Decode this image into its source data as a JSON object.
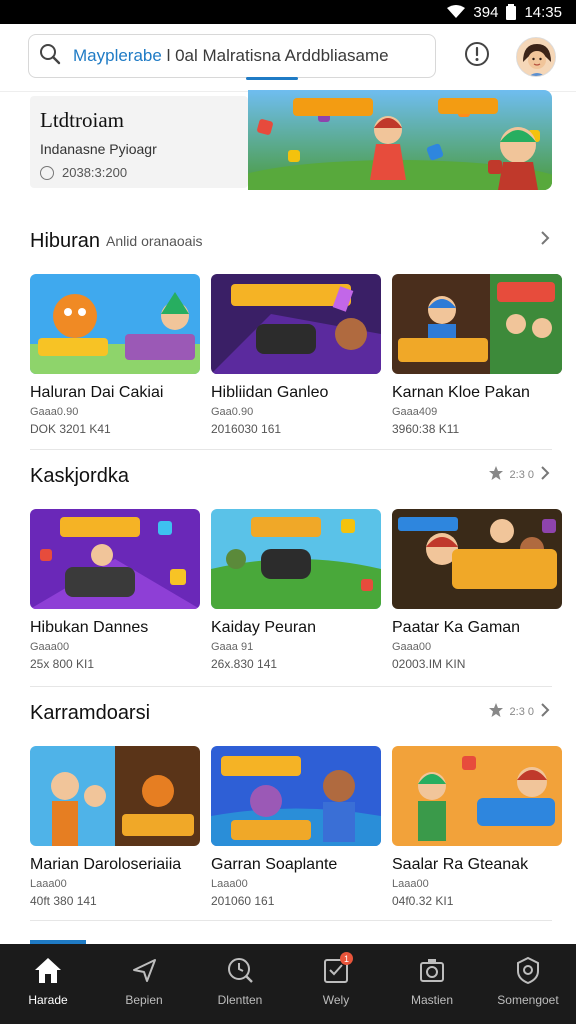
{
  "status_bar": {
    "signal": "394",
    "time": "14:35"
  },
  "header": {
    "search_accent": "Mayplerabe",
    "search_rest": "l 0al Malratisna Arddbliasame",
    "icons": [
      "search-icon",
      "info-icon",
      "avatar"
    ]
  },
  "featured": {
    "title": "Ltdtroiam",
    "subtitle": "Indanasne Pyioagr",
    "time": "2038:3:200"
  },
  "sections": [
    {
      "title": "Hiburan",
      "subtitle": "Anlid oranaoais",
      "action_label": "",
      "cards": [
        {
          "title": "Haluran Dai Cakiai",
          "meta1": "Gaaa0.90",
          "meta2": "DOK 3201 K41"
        },
        {
          "title": "Hibliidan Ganleo",
          "meta1": "Gaa0.90",
          "meta2": "2016030 161"
        },
        {
          "title": "Karnan Kloe Pakan",
          "meta1": "Gaaa409",
          "meta2": "3960:38 K11"
        }
      ]
    },
    {
      "title": "Kaskjordka",
      "subtitle": "",
      "action_label": "2:3 0",
      "cards": [
        {
          "title": "Hibukan Dannes",
          "meta1": "Gaaa00",
          "meta2": "25x 800 KI1"
        },
        {
          "title": "Kaiday Peuran",
          "meta1": "Gaaa 91",
          "meta2": "26x.830 141"
        },
        {
          "title": "Paatar Ka Gaman",
          "meta1": "Gaaa00",
          "meta2": "02003.IM KIN"
        }
      ]
    },
    {
      "title": "Karramdoarsi",
      "subtitle": "",
      "action_label": "2:3 0",
      "cards": [
        {
          "title": "Marian Daroloseriaiia",
          "meta1": "Laaa00",
          "meta2": "40ft 380 141"
        },
        {
          "title": "Garran Soaplante",
          "meta1": "Laaa00",
          "meta2": "201060 161"
        },
        {
          "title": "Saalar Ra Gteanak",
          "meta1": "Laaa00",
          "meta2": "04f0.32 KI1"
        }
      ]
    }
  ],
  "bottom_nav": [
    {
      "label": "Harade",
      "icon": "home-icon",
      "active": true
    },
    {
      "label": "Bepien",
      "icon": "navigate-icon",
      "active": false
    },
    {
      "label": "Dlentten",
      "icon": "clock-search-icon",
      "active": false
    },
    {
      "label": "Wely",
      "icon": "inbox-check-icon",
      "active": false,
      "badge": "1"
    },
    {
      "label": "Mastien",
      "icon": "camera-icon",
      "active": false
    },
    {
      "label": "Somengoet",
      "icon": "shield-settings-icon",
      "active": false
    }
  ]
}
